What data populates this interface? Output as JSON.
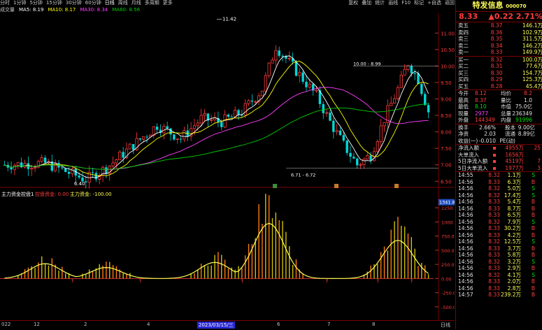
{
  "toolbar": {
    "items": [
      "分时",
      "1分钟",
      "5分钟",
      "15分钟",
      "30分钟",
      "60分钟",
      "日线",
      "周线",
      "月线",
      "多周期",
      "更多"
    ],
    "active_index": 6,
    "right_items": [
      "复权",
      "叠加",
      "统计",
      "画线",
      "F10",
      "标记",
      "+自选",
      "返回"
    ]
  },
  "ma": {
    "name": "成交量",
    "items": [
      {
        "label": "MA5: 8.19",
        "color": "#ffffff"
      },
      {
        "label": "MA10: 8.17",
        "color": "#ffff00"
      },
      {
        "label": "MA30: 8.34",
        "color": "#ff40ff"
      },
      {
        "label": "MA60: 8.56",
        "color": "#00d000"
      }
    ]
  },
  "annotations": {
    "high": "11.42",
    "low": "6.40",
    "mid_high": "10.00 - 8.99",
    "mid_low": "6.71 - 6.72"
  },
  "price_axis": [
    "11.00",
    "10.50",
    "10.00",
    "9.50",
    "9.00",
    "8.50",
    "8.00",
    "7.50",
    "7.00",
    "6.50"
  ],
  "indicator": {
    "title": "主力资金控盘1",
    "line1": "控盘资金: 0.00",
    "line2": "主力资金: -100.00",
    "axis": [
      "1250.00",
      "1000.00",
      "750.00",
      "500.00",
      "250.00",
      "0.00",
      "-250.00",
      "-500.00"
    ],
    "highlight": "1341.83"
  },
  "bottom": {
    "left_label": "022",
    "date_label": "2023/03/15/三",
    "month_ticks": [
      "12",
      "2",
      "4",
      "6",
      "7",
      "8"
    ],
    "right_label": "日线"
  },
  "panel": {
    "title": "特发信息",
    "code": "000070",
    "price": "8.33",
    "change": "▲0.22",
    "pct": "2.71%",
    "asks": [
      {
        "label": "卖五",
        "price": "8.37",
        "vol": "146.1万"
      },
      {
        "label": "卖四",
        "price": "8.36",
        "vol": "102.9万"
      },
      {
        "label": "卖三",
        "price": "8.35",
        "vol": "311.5万"
      },
      {
        "label": "卖二",
        "price": "8.34",
        "vol": "146.2万"
      },
      {
        "label": "卖一",
        "price": "8.33",
        "vol": "149.9万"
      }
    ],
    "bids": [
      {
        "label": "买一",
        "price": "8.32",
        "vol": "100.0万"
      },
      {
        "label": "买二",
        "price": "8.31",
        "vol": "77.6万"
      },
      {
        "label": "买三",
        "price": "8.30",
        "vol": "154.7万"
      },
      {
        "label": "买四",
        "price": "8.29",
        "vol": "125.3万"
      },
      {
        "label": "买五",
        "price": "8.28",
        "vol": "45.4万"
      }
    ],
    "stats": [
      {
        "k1": "今开",
        "v1": "8.12",
        "k2": "均价",
        "v2": "8.2",
        "c1": "red",
        "c2": "red"
      },
      {
        "k1": "最高",
        "v1": "8.37",
        "k2": "量比",
        "v2": "1.0",
        "c1": "red",
        "c2": "wht"
      },
      {
        "k1": "最低",
        "v1": "8.10",
        "k2": "市值",
        "v2": "75.0亿",
        "c1": "green",
        "c2": "wht"
      },
      {
        "k1": "现量",
        "v1": "2977",
        "k2": "总量",
        "v2": "236349",
        "c1": "mag",
        "c2": "wht"
      },
      {
        "k1": "外盘",
        "v1": "144349",
        "k2": "内盘",
        "v2": "91996",
        "c1": "red",
        "c2": "green"
      }
    ],
    "stats2": [
      {
        "k1": "换手",
        "v1": "2.66%",
        "k2": "股本",
        "v2": "9.00亿"
      },
      {
        "k1": "净资",
        "v1": "2.03",
        "k2": "流通",
        "v2": "8.89亿"
      },
      {
        "k1": "收益(一)",
        "v1": "-0.010",
        "k2": "PE(动)",
        "v2": ""
      }
    ],
    "flows": [
      {
        "label": "净流入额",
        "value": "4955万",
        "extra": "25"
      },
      {
        "label": "大单流入",
        "value": "1656万",
        "extra": ""
      },
      {
        "label": "5日净流入额",
        "value": "4519万",
        "extra": "7"
      },
      {
        "label": "5日大单流入",
        "value": "1977万",
        "extra": "3"
      }
    ],
    "ticks": [
      [
        "14:55",
        "8.32",
        "1.1万",
        "S"
      ],
      [
        "14:56",
        "8.33",
        "6.3万",
        "B"
      ],
      [
        "14:56",
        "8.32",
        "5.0万",
        "S"
      ],
      [
        "14:56",
        "8.32",
        "17.4万",
        "S"
      ],
      [
        "14:56",
        "8.33",
        "5.4万",
        "B"
      ],
      [
        "14:56",
        "8.33",
        "8.7万",
        "B"
      ],
      [
        "14:56",
        "8.33",
        "6.5万",
        "B"
      ],
      [
        "14:56",
        "8.32",
        "7.9万",
        "S"
      ],
      [
        "14:56",
        "8.33",
        "30.2万",
        "B"
      ],
      [
        "14:56",
        "8.33",
        "4.2万",
        "B"
      ],
      [
        "14:56",
        "8.32",
        "12.5万",
        "S"
      ],
      [
        "14:56",
        "8.33",
        "3.7万",
        "B"
      ],
      [
        "14:56",
        "8.33",
        "5.8万",
        "B"
      ],
      [
        "14:56",
        "8.32",
        "3.2万",
        "S"
      ],
      [
        "14:56",
        "8.33",
        "2.9万",
        "B"
      ],
      [
        "14:56",
        "8.32",
        "4.1万",
        "S"
      ],
      [
        "14:56",
        "8.33",
        "2.0万",
        "B"
      ],
      [
        "14:56",
        "8.33",
        "2.8万",
        "B"
      ],
      [
        "14:57",
        "8.33",
        "239.2万",
        "B"
      ]
    ]
  },
  "colors": {
    "up": "#ff3c3c",
    "down": "#00d8d8",
    "ma5": "#ffffff",
    "ma10": "#ffff00",
    "ma30": "#ff40ff",
    "ma60": "#00d000"
  }
}
